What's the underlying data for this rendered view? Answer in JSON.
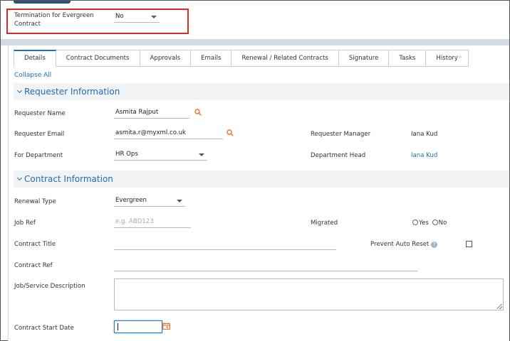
{
  "termination": {
    "label": "Termination for Evergreen Contract",
    "value": "No"
  },
  "tabs": [
    {
      "label": "Details"
    },
    {
      "label": "Contract Documents"
    },
    {
      "label": "Approvals"
    },
    {
      "label": "Emails"
    },
    {
      "label": "Renewal / Related Contracts"
    },
    {
      "label": "Signature"
    },
    {
      "label": "Tasks"
    },
    {
      "label": "History"
    }
  ],
  "tab_scroll": "«»",
  "collapse_all": "Collapse All",
  "requester": {
    "title": "Requester Information",
    "name_label": "Requester Name",
    "name_value": "Asmita Rajput",
    "email_label": "Requester Email",
    "email_value": "asmita.r@myxml.co.uk",
    "manager_label": "Requester Manager",
    "manager_value": "Iana Kud",
    "dept_label": "For Department",
    "dept_value": "HR Ops",
    "head_label": "Department Head",
    "head_value": "Iana Kud"
  },
  "contract": {
    "title": "Contract Information",
    "renewal_label": "Renewal Type",
    "renewal_value": "Evergreen",
    "jobref_label": "Job Ref",
    "jobref_placeholder": "e.g. ABD123",
    "migrated_label": "Migrated",
    "yes_label": "Yes",
    "no_label": "No",
    "title_label": "Contract Title",
    "prevent_label": "Prevent Auto Reset",
    "help_glyph": "?",
    "ref_label": "Contract Ref",
    "desc_label": "Job/Service Description",
    "start_label": "Contract Start Date"
  },
  "colors": {
    "accent": "#1e72b6",
    "highlight": "#d92a2a",
    "search_icon": "#e8742a"
  }
}
